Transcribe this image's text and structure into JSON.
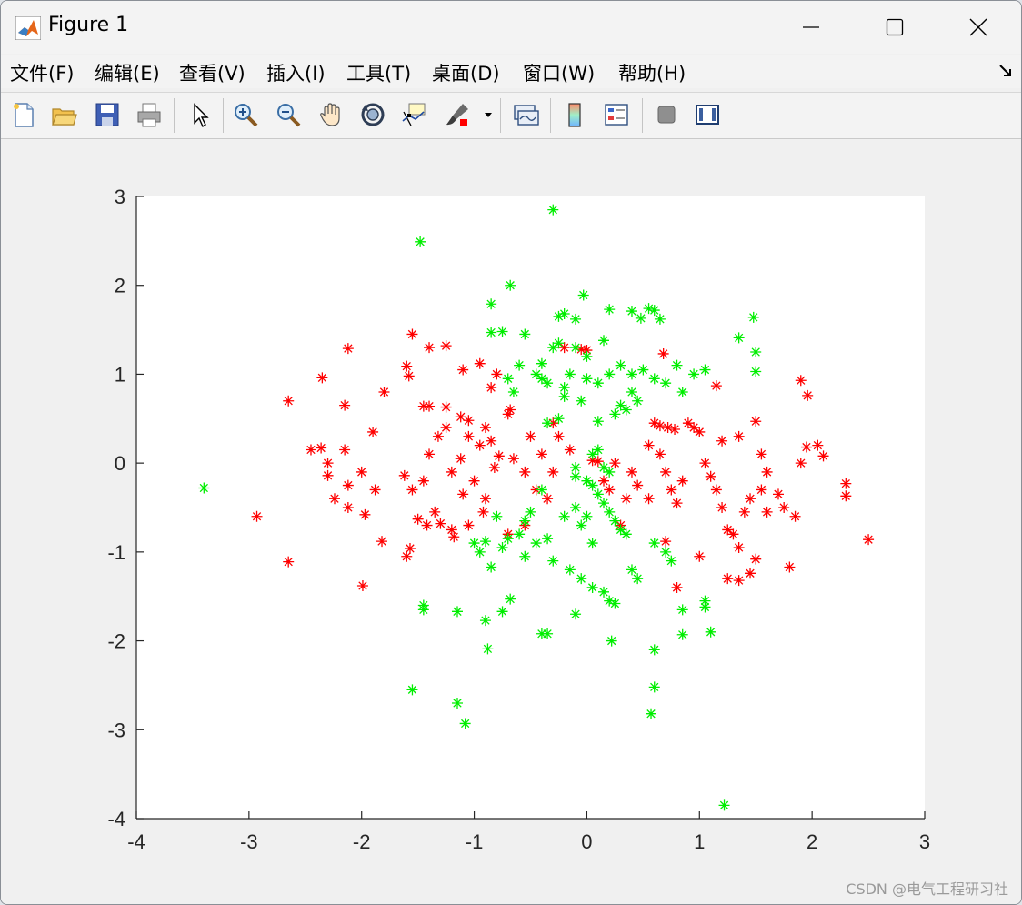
{
  "window": {
    "title": "Figure 1"
  },
  "menu": [
    "文件(F)",
    "编辑(E)",
    "查看(V)",
    "插入(I)",
    "工具(T)",
    "桌面(D)",
    "窗口(W)",
    "帮助(H)"
  ],
  "toolbar": {
    "icons": [
      "new-figure-icon",
      "open-file-icon",
      "save-icon",
      "print-icon",
      "edit-plot-arrow-icon",
      "zoom-in-icon",
      "zoom-out-icon",
      "pan-hand-icon",
      "rotate-3d-icon",
      "data-cursor-icon",
      "brush-icon",
      "brush-dropdown-icon",
      "link-plot-icon",
      "colorbar-icon",
      "legend-icon",
      "hide-plot-tools-icon",
      "show-plot-tools-icon"
    ]
  },
  "watermark": "CSDN @电气工程研习社",
  "colors": {
    "series_red": "#ff0000",
    "series_green": "#00ee00",
    "axes_bg": "#ffffff",
    "figure_bg": "#f0f0f0"
  },
  "chart_data": {
    "type": "scatter",
    "marker": "asterisk",
    "xlim": [
      -4,
      3
    ],
    "ylim": [
      -4,
      3
    ],
    "xticks": [
      -4,
      -3,
      -2,
      -1,
      0,
      1,
      2,
      3
    ],
    "yticks": [
      -4,
      -3,
      -2,
      -1,
      0,
      1,
      2,
      3
    ],
    "xtick_labels": [
      "-4",
      "-3",
      "-2",
      "-1",
      "0",
      "1",
      "2",
      "3"
    ],
    "ytick_labels": [
      "-4",
      "-3",
      "-2",
      "-1",
      "0",
      "1",
      "2",
      "3"
    ],
    "grid": false,
    "series": [
      {
        "color": "#ff0000",
        "points": [
          [
            -2.65,
            0.7
          ],
          [
            -2.35,
            0.96
          ],
          [
            -2.12,
            1.29
          ],
          [
            -2.15,
            0.65
          ],
          [
            -1.8,
            0.8
          ],
          [
            -1.55,
            1.45
          ],
          [
            -1.4,
            1.3
          ],
          [
            -1.25,
            1.32
          ],
          [
            -1.6,
            1.09
          ],
          [
            -1.58,
            0.98
          ],
          [
            -1.1,
            1.05
          ],
          [
            -0.95,
            1.12
          ],
          [
            -0.8,
            1.0
          ],
          [
            -0.85,
            0.85
          ],
          [
            -2.45,
            0.15
          ],
          [
            -2.36,
            0.17
          ],
          [
            -2.3,
            0.0
          ],
          [
            -2.15,
            0.15
          ],
          [
            -2.3,
            -0.14
          ],
          [
            -2.12,
            -0.25
          ],
          [
            -2.0,
            -0.1
          ],
          [
            -1.88,
            -0.3
          ],
          [
            -1.97,
            -0.58
          ],
          [
            -2.12,
            -0.5
          ],
          [
            -2.24,
            -0.4
          ],
          [
            -1.62,
            -0.14
          ],
          [
            -1.55,
            -0.3
          ],
          [
            -1.45,
            -0.2
          ],
          [
            -1.4,
            0.1
          ],
          [
            -1.32,
            0.3
          ],
          [
            -1.25,
            0.4
          ],
          [
            -1.12,
            0.05
          ],
          [
            -1.05,
            0.3
          ],
          [
            -0.95,
            0.2
          ],
          [
            -0.85,
            0.25
          ],
          [
            -0.82,
            -0.05
          ],
          [
            -0.78,
            0.08
          ],
          [
            -0.65,
            0.05
          ],
          [
            -0.55,
            -0.1
          ],
          [
            -0.45,
            -0.3
          ],
          [
            -0.35,
            -0.4
          ],
          [
            -0.3,
            -0.1
          ],
          [
            -2.93,
            -0.6
          ],
          [
            -2.65,
            -1.11
          ],
          [
            -1.99,
            -1.38
          ],
          [
            -1.82,
            -0.88
          ],
          [
            -1.6,
            -1.05
          ],
          [
            -1.57,
            -0.96
          ],
          [
            -1.5,
            -0.63
          ],
          [
            -1.42,
            -0.7
          ],
          [
            -1.35,
            -0.55
          ],
          [
            -1.3,
            -0.68
          ],
          [
            -1.2,
            -0.75
          ],
          [
            -1.18,
            -0.83
          ],
          [
            -1.05,
            -0.7
          ],
          [
            -0.92,
            -0.55
          ],
          [
            -1.9,
            0.35
          ],
          [
            -1.45,
            0.64
          ],
          [
            -1.4,
            0.64
          ],
          [
            -1.25,
            0.63
          ],
          [
            -1.12,
            0.52
          ],
          [
            -1.05,
            0.48
          ],
          [
            -0.9,
            0.4
          ],
          [
            -0.7,
            0.55
          ],
          [
            -0.68,
            0.6
          ],
          [
            -0.5,
            0.3
          ],
          [
            -0.4,
            0.1
          ],
          [
            -0.3,
            0.45
          ],
          [
            -0.2,
            1.3
          ],
          [
            -0.05,
            1.28
          ],
          [
            0.0,
            1.27
          ],
          [
            0.05,
            0.03
          ],
          [
            0.15,
            -0.2
          ],
          [
            0.2,
            -0.3
          ],
          [
            0.35,
            -0.4
          ],
          [
            0.4,
            -0.1
          ],
          [
            0.45,
            -0.25
          ],
          [
            0.55,
            0.2
          ],
          [
            0.6,
            0.45
          ],
          [
            0.65,
            0.1
          ],
          [
            0.7,
            -0.1
          ],
          [
            0.75,
            -0.3
          ],
          [
            0.8,
            -0.45
          ],
          [
            0.85,
            -0.2
          ],
          [
            0.68,
            1.23
          ],
          [
            0.65,
            0.42
          ],
          [
            0.72,
            0.4
          ],
          [
            0.78,
            0.38
          ],
          [
            0.9,
            0.45
          ],
          [
            0.95,
            0.4
          ],
          [
            1.0,
            0.35
          ],
          [
            1.05,
            0.0
          ],
          [
            1.1,
            -0.15
          ],
          [
            1.15,
            -0.3
          ],
          [
            1.2,
            -0.5
          ],
          [
            1.25,
            -0.75
          ],
          [
            1.3,
            -0.8
          ],
          [
            1.35,
            -0.95
          ],
          [
            1.15,
            0.87
          ],
          [
            1.2,
            0.25
          ],
          [
            1.35,
            0.3
          ],
          [
            1.5,
            0.47
          ],
          [
            1.55,
            0.1
          ],
          [
            1.6,
            -0.1
          ],
          [
            1.7,
            -0.35
          ],
          [
            1.75,
            -0.5
          ],
          [
            1.85,
            -0.6
          ],
          [
            1.9,
            0.0
          ],
          [
            1.95,
            0.18
          ],
          [
            2.05,
            0.2
          ],
          [
            2.1,
            0.08
          ],
          [
            2.3,
            -0.23
          ],
          [
            1.9,
            0.93
          ],
          [
            1.96,
            0.76
          ],
          [
            2.3,
            -0.37
          ],
          [
            2.5,
            -0.86
          ],
          [
            1.8,
            -1.17
          ],
          [
            1.5,
            -1.08
          ],
          [
            1.45,
            -1.24
          ],
          [
            1.35,
            -1.32
          ],
          [
            1.25,
            -1.3
          ],
          [
            1.0,
            -1.05
          ],
          [
            0.8,
            -1.4
          ],
          [
            0.7,
            -0.88
          ],
          [
            0.55,
            -0.4
          ],
          [
            0.3,
            -0.7
          ],
          [
            -0.55,
            -0.7
          ],
          [
            -0.7,
            -0.8
          ],
          [
            -0.9,
            -0.4
          ],
          [
            -1.0,
            -0.2
          ],
          [
            -1.1,
            -0.35
          ],
          [
            -1.2,
            -0.1
          ],
          [
            -0.25,
            0.3
          ],
          [
            -0.15,
            0.15
          ],
          [
            0.1,
            0.02
          ],
          [
            0.25,
            0.0
          ],
          [
            1.4,
            -0.55
          ],
          [
            1.45,
            -0.4
          ],
          [
            1.55,
            -0.3
          ],
          [
            1.6,
            -0.55
          ]
        ]
      },
      {
        "color": "#00ee00",
        "points": [
          [
            -0.3,
            2.85
          ],
          [
            -1.48,
            2.49
          ],
          [
            -0.68,
            2.0
          ],
          [
            -0.03,
            1.89
          ],
          [
            -0.85,
            1.79
          ],
          [
            -0.2,
            1.68
          ],
          [
            0.2,
            1.73
          ],
          [
            0.4,
            1.71
          ],
          [
            0.55,
            1.74
          ],
          [
            0.6,
            1.72
          ],
          [
            0.65,
            1.62
          ],
          [
            0.48,
            1.63
          ],
          [
            1.48,
            1.64
          ],
          [
            1.35,
            1.41
          ],
          [
            -0.85,
            1.47
          ],
          [
            -0.75,
            1.48
          ],
          [
            -0.55,
            1.45
          ],
          [
            -0.4,
            1.12
          ],
          [
            -0.3,
            1.3
          ],
          [
            -0.25,
            1.35
          ],
          [
            -0.1,
            1.3
          ],
          [
            0.0,
            1.2
          ],
          [
            0.15,
            1.38
          ],
          [
            -0.1,
            1.62
          ],
          [
            -0.25,
            1.65
          ],
          [
            -0.6,
            1.1
          ],
          [
            -0.7,
            0.95
          ],
          [
            -0.65,
            0.8
          ],
          [
            -0.45,
            1.0
          ],
          [
            -0.4,
            0.95
          ],
          [
            -0.35,
            0.9
          ],
          [
            -0.2,
            0.85
          ],
          [
            -0.15,
            1.0
          ],
          [
            0.0,
            0.95
          ],
          [
            0.1,
            0.9
          ],
          [
            0.2,
            1.0
          ],
          [
            0.3,
            1.1
          ],
          [
            0.4,
            1.0
          ],
          [
            0.5,
            1.05
          ],
          [
            0.6,
            0.95
          ],
          [
            0.7,
            0.9
          ],
          [
            0.85,
            0.8
          ],
          [
            1.5,
            1.25
          ],
          [
            1.5,
            1.03
          ],
          [
            1.05,
            1.05
          ],
          [
            0.95,
            1.0
          ],
          [
            0.8,
            1.1
          ],
          [
            0.45,
            0.7
          ],
          [
            0.35,
            0.6
          ],
          [
            0.3,
            0.65
          ],
          [
            0.25,
            0.55
          ],
          [
            0.1,
            0.47
          ],
          [
            -0.25,
            0.5
          ],
          [
            -0.35,
            0.45
          ],
          [
            -0.2,
            0.75
          ],
          [
            -0.05,
            0.7
          ],
          [
            -3.4,
            -0.28
          ],
          [
            -0.1,
            -0.15
          ],
          [
            0.0,
            -0.2
          ],
          [
            0.1,
            -0.35
          ],
          [
            0.15,
            -0.45
          ],
          [
            0.2,
            -0.55
          ],
          [
            0.25,
            -0.65
          ],
          [
            0.3,
            -0.75
          ],
          [
            0.35,
            -0.8
          ],
          [
            0.05,
            -0.9
          ],
          [
            0.0,
            -0.6
          ],
          [
            -0.05,
            -0.7
          ],
          [
            -0.1,
            -0.5
          ],
          [
            -0.2,
            -0.6
          ],
          [
            -0.4,
            -0.3
          ],
          [
            -0.5,
            -0.55
          ],
          [
            -0.55,
            -0.65
          ],
          [
            -0.6,
            -0.8
          ],
          [
            -0.7,
            -0.85
          ],
          [
            -0.75,
            -0.95
          ],
          [
            -0.8,
            -0.6
          ],
          [
            -0.9,
            -0.88
          ],
          [
            -0.95,
            -1.0
          ],
          [
            -1.0,
            -0.9
          ],
          [
            -0.85,
            -1.17
          ],
          [
            -0.55,
            -1.05
          ],
          [
            -0.45,
            -0.9
          ],
          [
            -0.35,
            -0.85
          ],
          [
            -0.3,
            -1.1
          ],
          [
            -0.15,
            -1.2
          ],
          [
            -0.05,
            -1.3
          ],
          [
            0.05,
            -1.4
          ],
          [
            0.15,
            -1.45
          ],
          [
            0.2,
            -1.55
          ],
          [
            0.25,
            -1.58
          ],
          [
            0.4,
            -1.2
          ],
          [
            0.45,
            -1.3
          ],
          [
            0.6,
            -0.9
          ],
          [
            0.7,
            -1.0
          ],
          [
            0.75,
            -1.1
          ],
          [
            0.85,
            -1.65
          ],
          [
            0.85,
            -1.93
          ],
          [
            1.05,
            -1.55
          ],
          [
            1.05,
            -1.62
          ],
          [
            1.1,
            -1.9
          ],
          [
            -1.45,
            -1.6
          ],
          [
            -1.45,
            -1.65
          ],
          [
            -1.15,
            -1.67
          ],
          [
            -0.9,
            -1.77
          ],
          [
            -0.75,
            -1.67
          ],
          [
            -0.68,
            -1.53
          ],
          [
            -0.4,
            -1.92
          ],
          [
            -0.35,
            -1.92
          ],
          [
            -0.1,
            -1.7
          ],
          [
            0.22,
            -2.0
          ],
          [
            -0.88,
            -2.09
          ],
          [
            -1.55,
            -2.55
          ],
          [
            -1.15,
            -2.7
          ],
          [
            -1.08,
            -2.93
          ],
          [
            0.6,
            -2.1
          ],
          [
            0.6,
            -2.52
          ],
          [
            0.57,
            -2.82
          ],
          [
            1.22,
            -3.85
          ],
          [
            0.1,
            0.15
          ],
          [
            0.05,
            0.1
          ],
          [
            -0.1,
            -0.05
          ],
          [
            0.15,
            -0.05
          ],
          [
            0.2,
            -0.1
          ],
          [
            0.05,
            -0.25
          ],
          [
            0.4,
            0.8
          ]
        ]
      }
    ]
  }
}
